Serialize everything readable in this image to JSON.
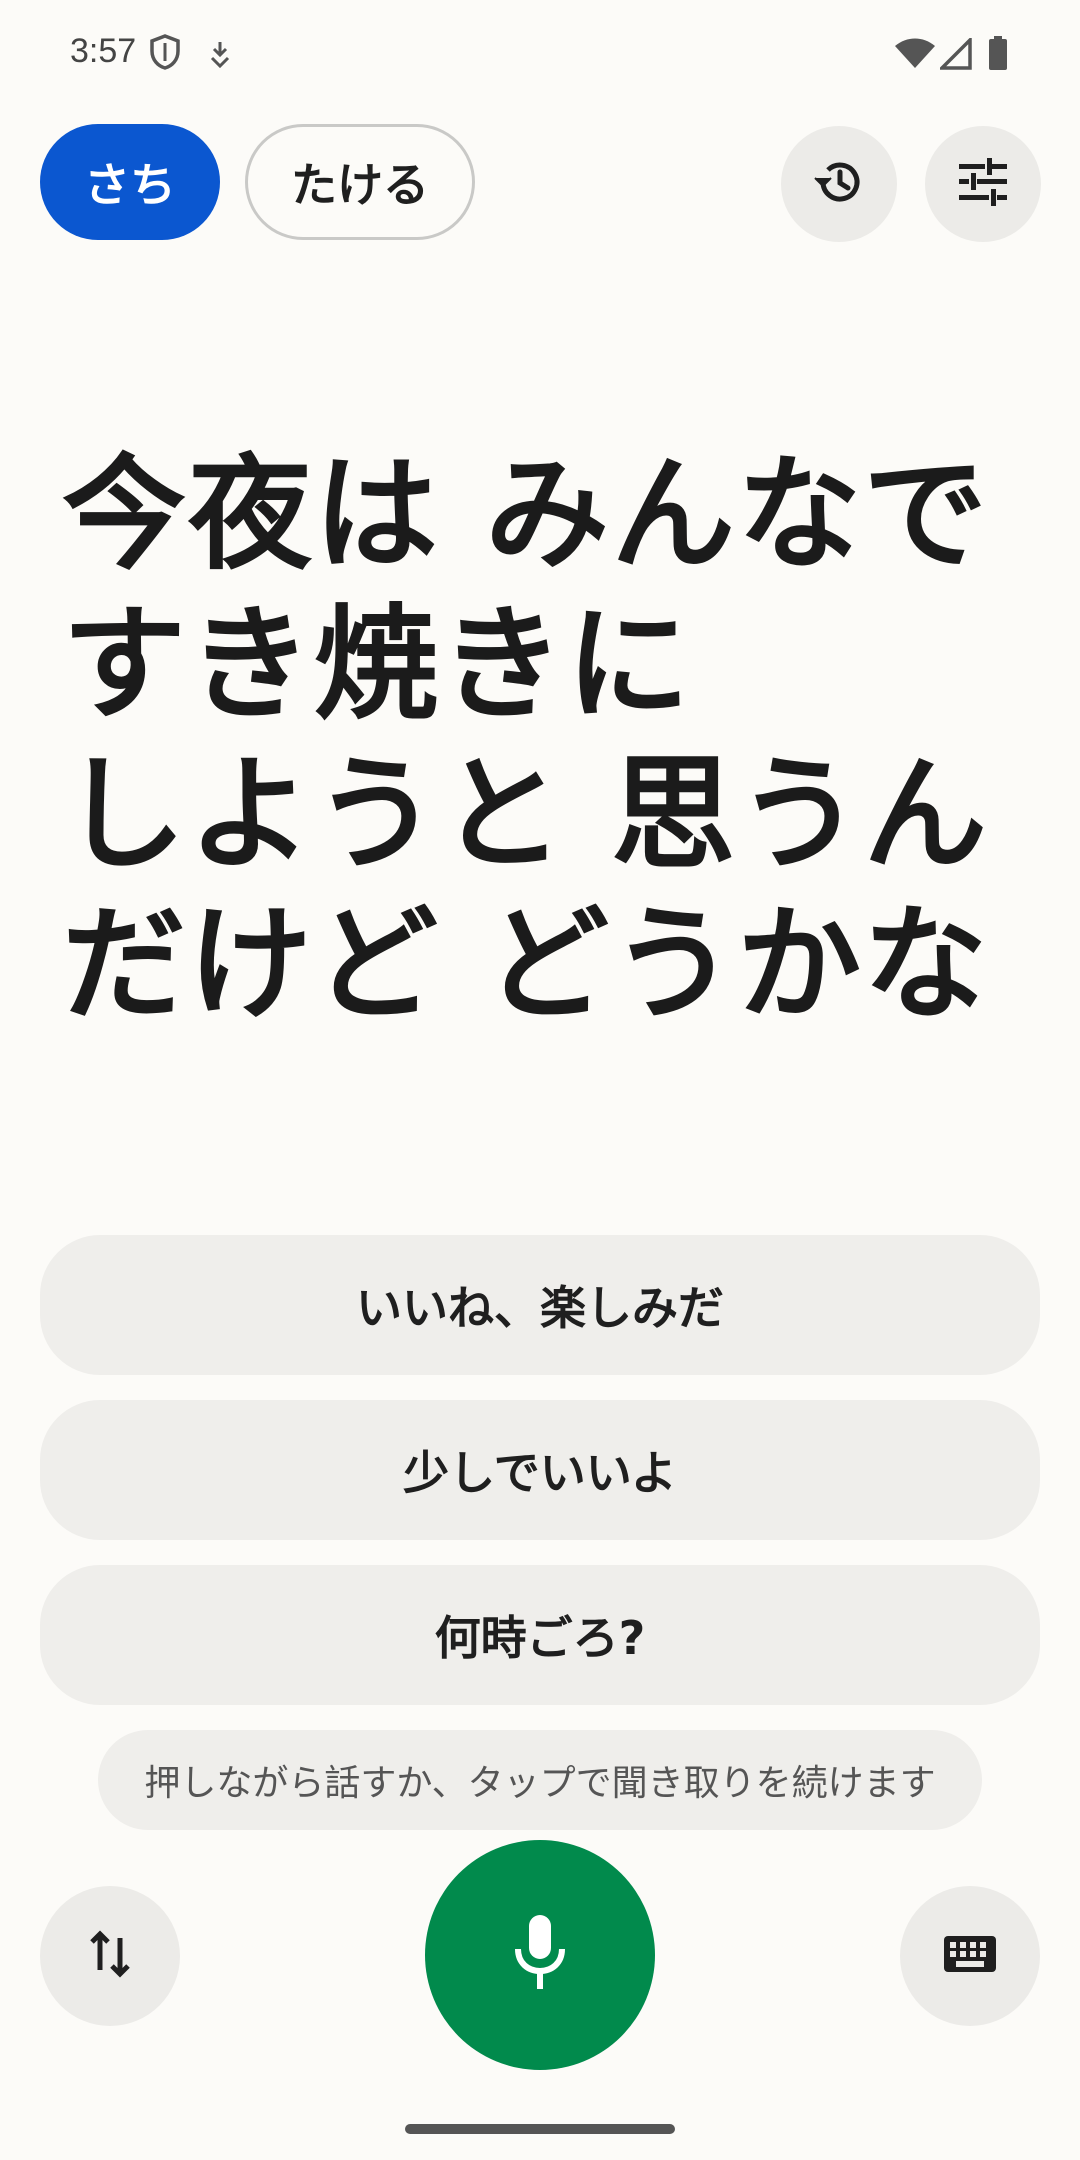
{
  "status_bar": {
    "time": "3:57",
    "icons": [
      "shield-icon",
      "location-download-icon",
      "wifi-icon",
      "signal-icon",
      "battery-icon"
    ]
  },
  "speakers": {
    "active": "さち",
    "inactive": "たける"
  },
  "header_icons": [
    "history-icon",
    "settings-sliders-icon"
  ],
  "transcript": {
    "lines": [
      "今夜は みんなで",
      "すき焼きに",
      "しようと 思うん",
      "だけど どうかな"
    ]
  },
  "suggestions": [
    "いいね、楽しみだ",
    "少しでいいよ",
    "何時ごろ?"
  ],
  "hint": "押しながら話すか、タップで聞き取りを続けます",
  "bottom_bar": {
    "left_icon": "swap-vertical-icon",
    "center_icon": "microphone-icon",
    "right_icon": "keyboard-icon"
  },
  "colors": {
    "active_chip": "#0b57d0",
    "mic_button": "#018a4c",
    "background": "#fcfbf8",
    "surface": "#efeeeb"
  }
}
